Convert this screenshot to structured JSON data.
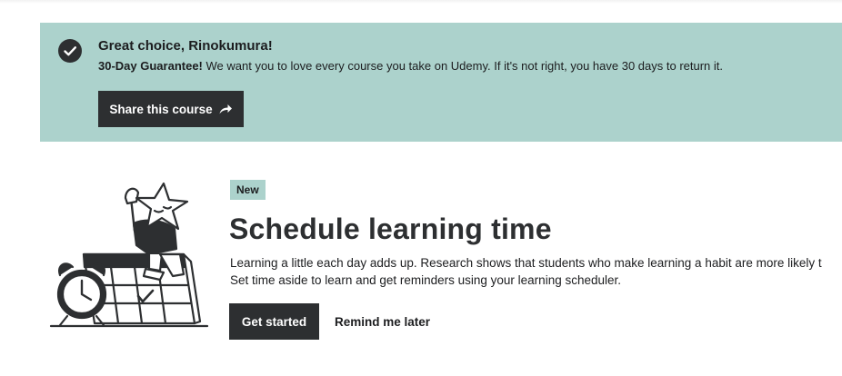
{
  "banner": {
    "icon": "check-circle-icon",
    "title": "Great choice, Rinokumura!",
    "guarantee_label": "30-Day Guarantee!",
    "guarantee_text": " We want you to love every course you take on Udemy. If it's not right, you have 30 days to return it.",
    "share_label": "Share this course",
    "share_icon": "share-arrow-icon",
    "background_color": "#acd2cc"
  },
  "schedule": {
    "illustration": "calendar-clock-star-character-illustration",
    "badge": "New",
    "title": "Schedule learning time",
    "description_line1": "Learning a little each day adds up. Research shows that students who make learning a habit are more likely t",
    "description_line2": "Set time aside to learn and get reminders using your learning scheduler.",
    "primary_button": "Get started",
    "secondary_button": "Remind me later"
  },
  "colors": {
    "dark": "#2d2f31",
    "accent": "#acd2cc"
  }
}
